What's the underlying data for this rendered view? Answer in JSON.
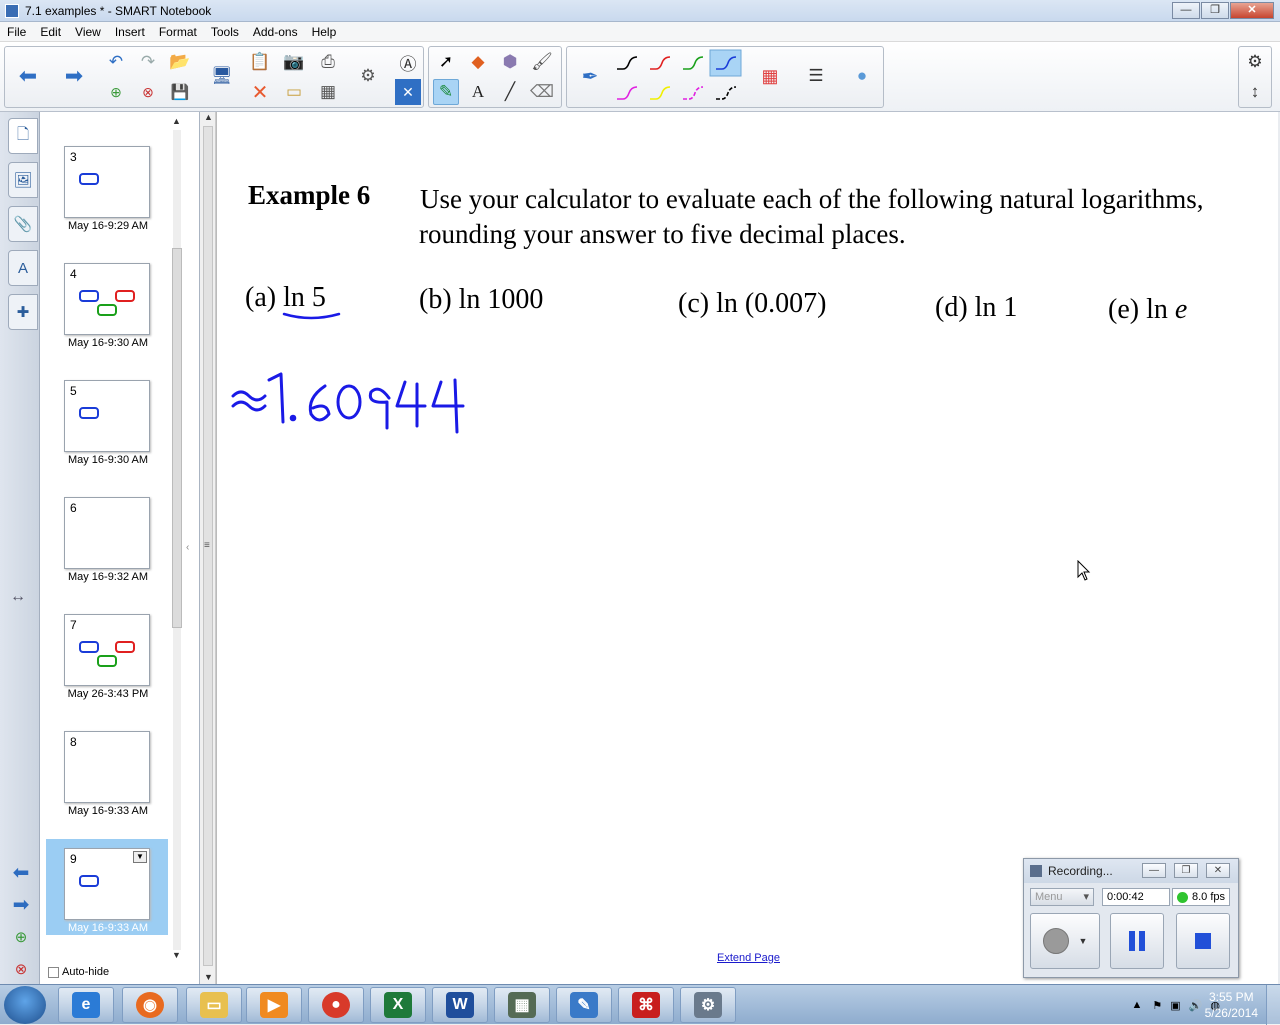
{
  "window": {
    "title": "7.1 examples * - SMART Notebook",
    "min": "—",
    "max": "❐",
    "close": "✕"
  },
  "menu": [
    "File",
    "Edit",
    "View",
    "Insert",
    "Format",
    "Tools",
    "Add-ons",
    "Help"
  ],
  "toolbar": {
    "icons": [
      "back-icon",
      "forward-icon",
      "undo-icon",
      "redo-icon",
      "add-page-icon",
      "delete-page-icon",
      "open-file-icon",
      "save-icon",
      "screen-shade-icon",
      "paste-icon",
      "screen-capture-icon",
      "document-camera-icon",
      "delete-icon",
      "table-icon",
      "select-icon",
      "shapes-icon",
      "pens-icon",
      "text-icon",
      "line-icon",
      "eraser-icon",
      "fill-icon",
      "magic-pen-icon",
      "settings-icon",
      "move-toolbar-icon"
    ],
    "pen_colors": [
      "#000000",
      "#e02020",
      "#1aa01a",
      "#1a3cd8",
      "#e020e0",
      "#f0f000",
      "#e020e0",
      "#000000"
    ],
    "selected_pen_index": 3
  },
  "sorter": {
    "pages": [
      {
        "num": "3",
        "label": "May 16-9:29 AM"
      },
      {
        "num": "4",
        "label": "May 16-9:30 AM"
      },
      {
        "num": "5",
        "label": "May 16-9:30 AM"
      },
      {
        "num": "6",
        "label": "May 16-9:32 AM"
      },
      {
        "num": "7",
        "label": "May 26-3:43 PM"
      },
      {
        "num": "8",
        "label": "May 16-9:33 AM"
      },
      {
        "num": "9",
        "label": "May 16-9:33 AM"
      }
    ],
    "selected_page": "9",
    "autohide_label": "Auto-hide"
  },
  "canvas": {
    "example_label": "Example 6",
    "instruction_line1": "Use your calculator to evaluate each of the following natural logarithms,",
    "instruction_line2": "rounding your answer to five decimal places.",
    "parts": {
      "a": "(a) ln 5",
      "b": "(b) ln 1000",
      "c": "(c) ln (0.007)",
      "d": "(d) ln 1",
      "e_prefix": "(e) ln ",
      "e_var": "e"
    },
    "ink_answer": "≈1.60944",
    "ink_color": "#1a1ae6",
    "extend_page": "Extend Page"
  },
  "recorder": {
    "title": "Recording...",
    "menu": "Menu",
    "time": "0:00:42",
    "fps": "8.0 fps",
    "status_color": "#2fc42f"
  },
  "taskbar": {
    "apps": [
      "internet-explorer",
      "firefox",
      "file-explorer",
      "media-player",
      "chrome",
      "excel",
      "word",
      "calculator-app",
      "smart-notebook",
      "acrobat",
      "recorder-app"
    ],
    "clock_time": "3:55 PM",
    "clock_date": "5/26/2014"
  }
}
